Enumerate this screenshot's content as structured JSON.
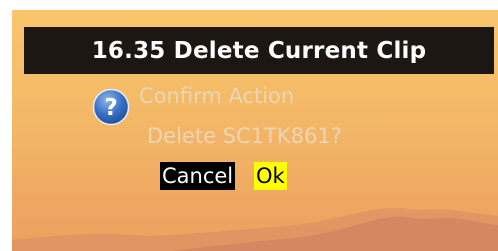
{
  "header": {
    "title": "16.35 Delete Current Clip"
  },
  "dialog": {
    "title": "Confirm Action",
    "message": "Delete SC1TK861?",
    "icon": "question-icon",
    "cancel_label": "Cancel",
    "ok_label": "Ok"
  },
  "colors": {
    "title_bar_bg": "#1c1712",
    "dialog_text": "#ecd6b7",
    "focused_button_bg": "#ffff00",
    "unfocused_button_bg": "#000000",
    "background_sky": "#f5bd68"
  }
}
